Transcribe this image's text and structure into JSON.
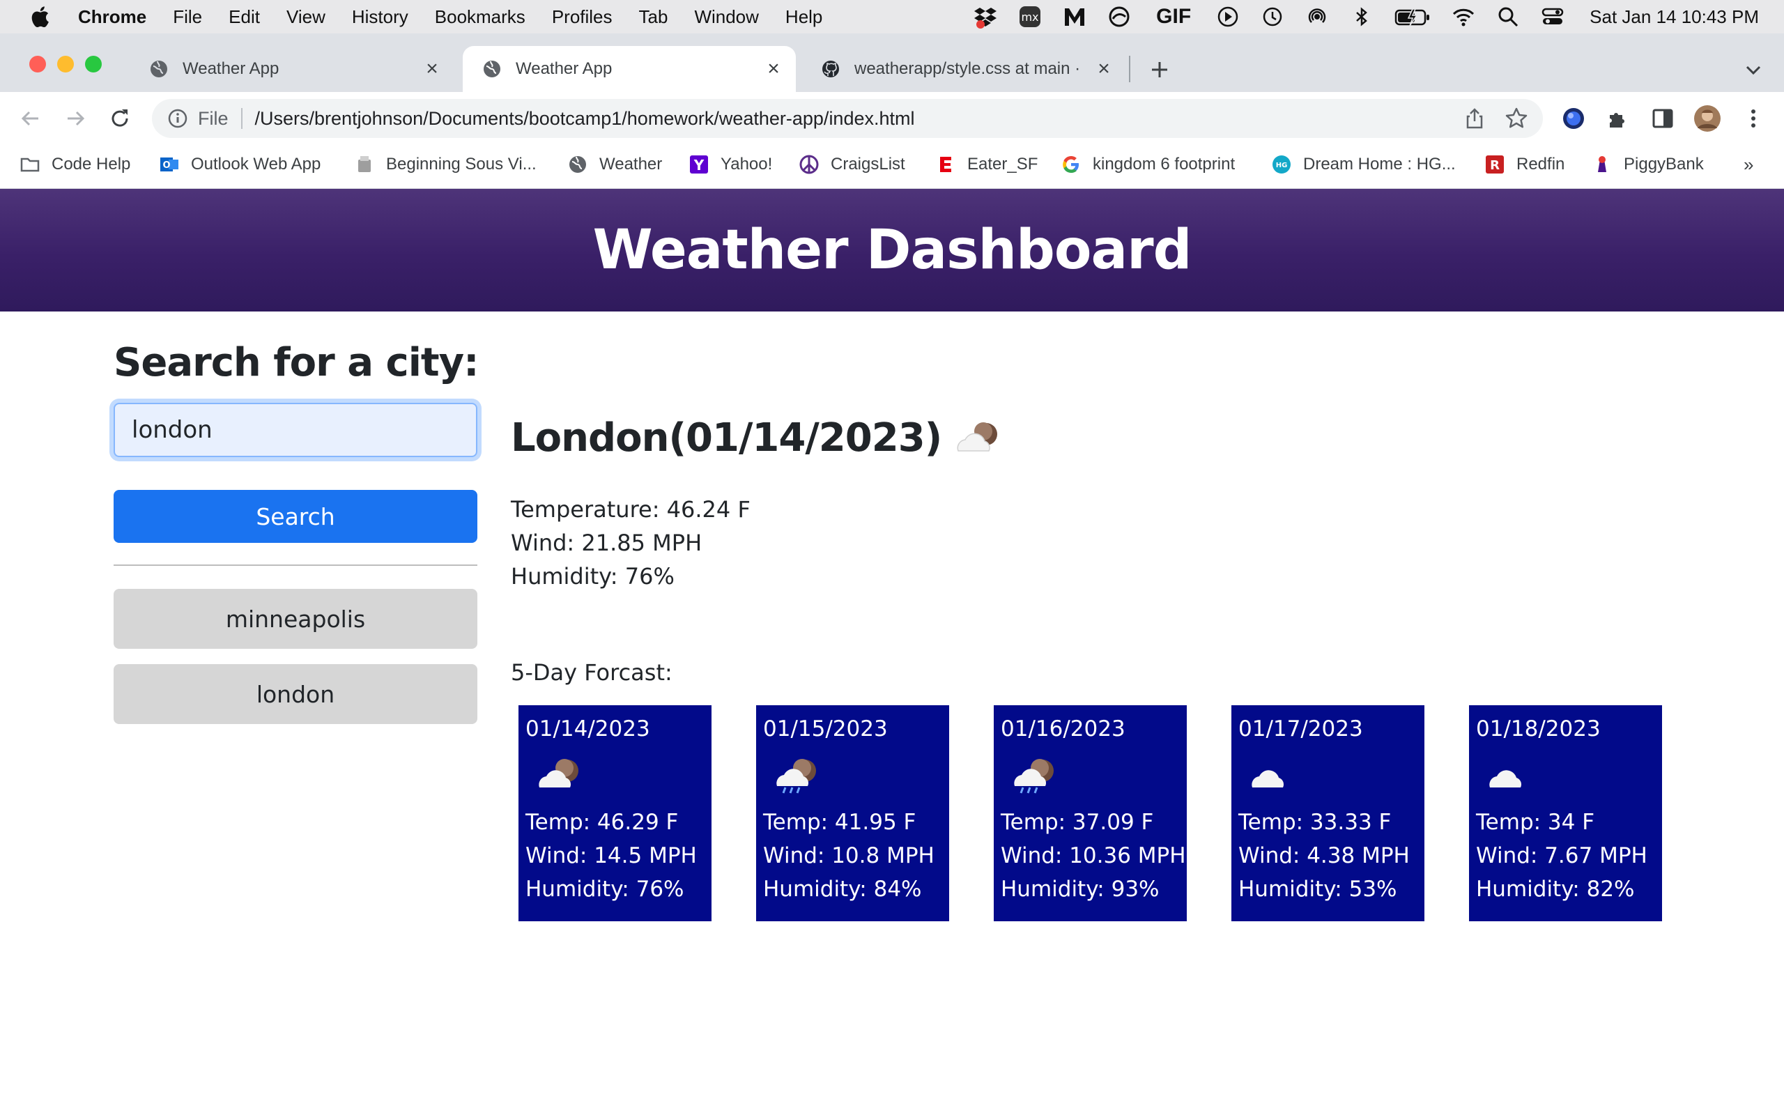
{
  "menubar": {
    "app": "Chrome",
    "items": [
      "File",
      "Edit",
      "View",
      "History",
      "Bookmarks",
      "Profiles",
      "Tab",
      "Window",
      "Help"
    ],
    "gif_label": "GIF",
    "clock": "Sat Jan 14  10:43 PM"
  },
  "tabs": [
    {
      "label": "Weather App"
    },
    {
      "label": "Weather App"
    },
    {
      "label": "weatherapp/style.css at main ·"
    }
  ],
  "omnibox": {
    "scheme_label": "File",
    "url": "/Users/brentjohnson/Documents/bootcamp1/homework/weather-app/index.html"
  },
  "bookmarks": [
    {
      "label": "Code Help",
      "icon": "folder-icon"
    },
    {
      "label": "Outlook Web App",
      "icon": "outlook-icon"
    },
    {
      "label": "Beginning Sous Vi...",
      "icon": "sous-vide-icon"
    },
    {
      "label": "Weather",
      "icon": "globe-icon"
    },
    {
      "label": "Yahoo!",
      "icon": "yahoo-icon"
    },
    {
      "label": "CraigsList",
      "icon": "peace-icon"
    },
    {
      "label": "Eater_SF",
      "icon": "eater-icon"
    },
    {
      "label": "kingdom 6 footprint",
      "icon": "google-icon"
    },
    {
      "label": "Dream Home : HG...",
      "icon": "hg-icon"
    },
    {
      "label": "Redfin",
      "icon": "redfin-icon"
    },
    {
      "label": "PiggyBank",
      "icon": "piggybank-icon"
    }
  ],
  "colors": {
    "header_bg": "#3a2068",
    "search_button": "#1a73f0",
    "history_button": "#d6d6d6",
    "forecast_card": "#020a8a"
  },
  "page": {
    "header_title": "Weather Dashboard",
    "search_heading": "Search for a city:",
    "search_value": "london",
    "search_button": "Search",
    "history": [
      "minneapolis",
      "london"
    ],
    "current": {
      "title": "London(01/14/2023)",
      "icon": "partly-cloudy-night-icon",
      "temperature": "Temperature: 46.24 F",
      "wind": "Wind: 21.85 MPH",
      "humidity": "Humidity: 76%"
    },
    "forecast_label": "5-Day Forcast:",
    "forecast": [
      {
        "date": "01/14/2023",
        "icon": "partly-cloudy-night-icon",
        "temp": "Temp: 46.29 F",
        "wind": "Wind: 14.5 MPH",
        "humidity": "Humidity: 76%"
      },
      {
        "date": "01/15/2023",
        "icon": "rain-night-icon",
        "temp": "Temp: 41.95 F",
        "wind": "Wind: 10.8 MPH",
        "humidity": "Humidity: 84%"
      },
      {
        "date": "01/16/2023",
        "icon": "rain-night-icon",
        "temp": "Temp: 37.09 F",
        "wind": "Wind: 10.36 MPH",
        "humidity": "Humidity: 93%"
      },
      {
        "date": "01/17/2023",
        "icon": "cloud-icon",
        "temp": "Temp: 33.33 F",
        "wind": "Wind: 4.38 MPH",
        "humidity": "Humidity: 53%"
      },
      {
        "date": "01/18/2023",
        "icon": "cloud-icon",
        "temp": "Temp: 34 F",
        "wind": "Wind: 7.67 MPH",
        "humidity": "Humidity: 82%"
      }
    ]
  }
}
